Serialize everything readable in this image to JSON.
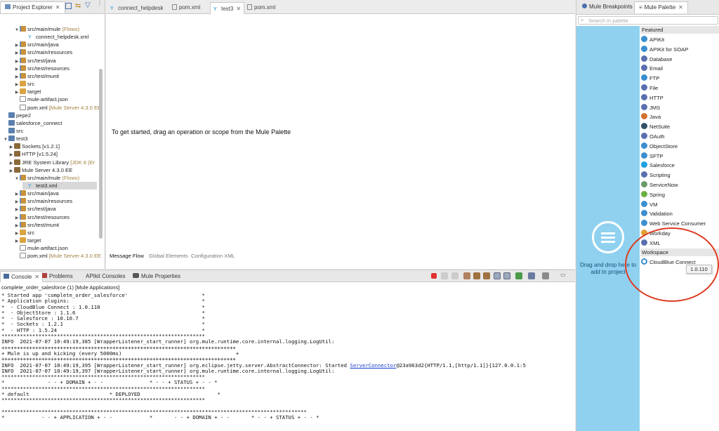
{
  "explorer": {
    "tab_label": "Project Explorer",
    "tree": [
      {
        "label": "src/main/mule",
        "deco": "(Flows)",
        "twisty": "▼",
        "icon": "pkgfolder"
      },
      {
        "label": "connect_helpdesk.xml",
        "deco": "",
        "twisty": "",
        "icon": "mule-file"
      },
      {
        "label": "src/main/java",
        "deco": "",
        "twisty": "▶",
        "icon": "pkgfolder"
      },
      {
        "label": "src/main/resources",
        "deco": "",
        "twisty": "▶",
        "icon": "pkgfolder"
      },
      {
        "label": "src/test/java",
        "deco": "",
        "twisty": "▶",
        "icon": "pkgfolder"
      },
      {
        "label": "src/test/resources",
        "deco": "",
        "twisty": "▶",
        "icon": "pkgfolder"
      },
      {
        "label": "src/test/munit",
        "deco": "",
        "twisty": "▶",
        "icon": "pkgfolder"
      },
      {
        "label": "src",
        "deco": "",
        "twisty": "▶",
        "icon": "folder"
      },
      {
        "label": "target",
        "deco": "",
        "twisty": "▶",
        "icon": "folder"
      },
      {
        "label": "mule-artifact.json",
        "deco": "",
        "twisty": "",
        "icon": "file"
      },
      {
        "label": "pom.xml",
        "deco": "[Mule Server 4.3.0 EE",
        "twisty": "",
        "icon": "xml-file"
      },
      {
        "label": "pepe2",
        "deco": "",
        "twisty": "",
        "icon": "project"
      },
      {
        "label": "salesforce_connect",
        "deco": "",
        "twisty": "",
        "icon": "project"
      },
      {
        "label": "src",
        "deco": "",
        "twisty": "",
        "icon": "project"
      },
      {
        "label": "test3",
        "deco": "",
        "twisty": "▼",
        "icon": "project"
      },
      {
        "label": "Sockets [v1.2.1]",
        "deco": "",
        "twisty": "▶",
        "icon": "library"
      },
      {
        "label": "HTTP [v1.5.24]",
        "deco": "",
        "twisty": "▶",
        "icon": "library"
      },
      {
        "label": "JRE System Library",
        "deco": "[JDK 8 (Er",
        "twisty": "▶",
        "icon": "library"
      },
      {
        "label": "Mule Server 4.3.0 EE",
        "deco": "",
        "twisty": "▶",
        "icon": "library"
      },
      {
        "label": "src/main/mule",
        "deco": "(Flows)",
        "twisty": "▼",
        "icon": "pkgfolder"
      },
      {
        "label": "test3.xml",
        "deco": "",
        "twisty": "",
        "icon": "mule-file"
      },
      {
        "label": "src/main/java",
        "deco": "",
        "twisty": "▶",
        "icon": "pkgfolder"
      },
      {
        "label": "src/main/resources",
        "deco": "",
        "twisty": "▶",
        "icon": "pkgfolder"
      },
      {
        "label": "src/test/java",
        "deco": "",
        "twisty": "▶",
        "icon": "pkgfolder"
      },
      {
        "label": "src/test/resources",
        "deco": "",
        "twisty": "▶",
        "icon": "pkgfolder"
      },
      {
        "label": "src/test/munit",
        "deco": "",
        "twisty": "▶",
        "icon": "pkgfolder"
      },
      {
        "label": "src",
        "deco": "",
        "twisty": "▶",
        "icon": "folder"
      },
      {
        "label": "target",
        "deco": "",
        "twisty": "▶",
        "icon": "folder"
      },
      {
        "label": "mule-artifact.json",
        "deco": "",
        "twisty": "",
        "icon": "file"
      },
      {
        "label": "pom.xml",
        "deco": "[Mule Server 4.3.0 EE",
        "twisty": "",
        "icon": "xml-file"
      }
    ]
  },
  "editor": {
    "tabs": [
      "connect_helpdesk",
      "pom.xml",
      "test3",
      "pom.xml"
    ],
    "active_tab": "test3",
    "hint": "To get started, drag an operation or scope from the Mule Palette",
    "bottom_tabs": [
      "Message Flow",
      "Global Elements",
      "Configuration XML"
    ]
  },
  "console": {
    "tabs": [
      "Console",
      "Problems",
      "APIkit Consoles",
      "Mule Properties"
    ],
    "title": "complete_order_salesforce (1) [Mule Applications]",
    "lines": [
      "* Started app 'complete_order_salesforce'                        *",
      "* Application plugins:                                           *",
      "*  - CloudBlue Connect : 1.0.110                                 *",
      "*  - ObjectStore : 1.1.6                                         *",
      "*  - Salesforce : 10.10.7                                        *",
      "*  - Sockets : 1.2.1                                             *",
      "*  - HTTP : 1.5.24                                               *",
      "******************************************************************",
      "INFO  2021-07-07 10:49:19,385 [WrapperListener_start_runner] org.mule.runtime.core.internal.logging.LogUtil:",
      "++++++++++++++++++++++++++++++++++++++++++++++++++++++++++++++++++++++++++++",
      "+ Mule is up and kicking (every 5000ms)                                     +",
      "++++++++++++++++++++++++++++++++++++++++++++++++++++++++++++++++++++++++++++",
      "INFO  2021-07-07 10:49:19,395 [WrapperListener_start_runner] org.eclipse.jetty.server.AbstractConnector: Started ",
      "INFO  2021-07-07 10:49:19,397 [WrapperListener_start_runner] org.mule.runtime.core.internal.logging.LogUtil:",
      "******************************************************************",
      "*              - - + DOMAIN + - -               * - - + STATUS + - - *",
      "******************************************************************",
      "* default                          * DEPLOYED                         *",
      "******************************************************************",
      "",
      "***************************************************************************************************",
      "*            - - + APPLICATION + - -            *       - - + DOMAIN + - -       * - - + STATUS + - - *"
    ],
    "link_text": "ServerConnector",
    "link_tail": "@23a963d2{HTTP/1.1,[http/1.1]}{127.0.0.1:5"
  },
  "palette": {
    "tabs": [
      "Mule Breakpoints",
      "Mule Palette"
    ],
    "search_placeholder": "Search in palette",
    "dropzone_text": "Drag and drop here to add to project",
    "featured_header": "Featured",
    "featured": [
      {
        "label": "APIKit",
        "color": "#3a8fd0"
      },
      {
        "label": "APIKit for SOAP",
        "color": "#3a8fd0"
      },
      {
        "label": "Database",
        "color": "#5a6fb0"
      },
      {
        "label": "Email",
        "color": "#5a6fb0"
      },
      {
        "label": "FTP",
        "color": "#3a8fd0"
      },
      {
        "label": "File",
        "color": "#5a6fb0"
      },
      {
        "label": "HTTP",
        "color": "#5a6fb0"
      },
      {
        "label": "JMS",
        "color": "#5a6fb0"
      },
      {
        "label": "Java",
        "color": "#d07030"
      },
      {
        "label": "NetSuite",
        "color": "#30506a"
      },
      {
        "label": "OAuth",
        "color": "#5a6fb0"
      },
      {
        "label": "ObjectStore",
        "color": "#3a8fd0"
      },
      {
        "label": "SFTP",
        "color": "#3a8fd0"
      },
      {
        "label": "Salesforce",
        "color": "#1fa0e0"
      },
      {
        "label": "Scripting",
        "color": "#5a6fb0"
      },
      {
        "label": "ServiceNow",
        "color": "#6a9a6a"
      },
      {
        "label": "Spring",
        "color": "#6ab040"
      },
      {
        "label": "VM",
        "color": "#3a8fd0"
      },
      {
        "label": "Validation",
        "color": "#3a8fd0"
      },
      {
        "label": "Web Service Consumer",
        "color": "#3a8fd0"
      },
      {
        "label": "Workday",
        "color": "#e0a030"
      },
      {
        "label": "XML",
        "color": "#5a6fb0"
      }
    ],
    "workspace_header": "Workspace",
    "workspace": [
      {
        "label": "CloudBlue Connect",
        "color": "#3a8fd0"
      }
    ],
    "tooltip": "1.0.110",
    "annotation_color": "#e03a20"
  }
}
